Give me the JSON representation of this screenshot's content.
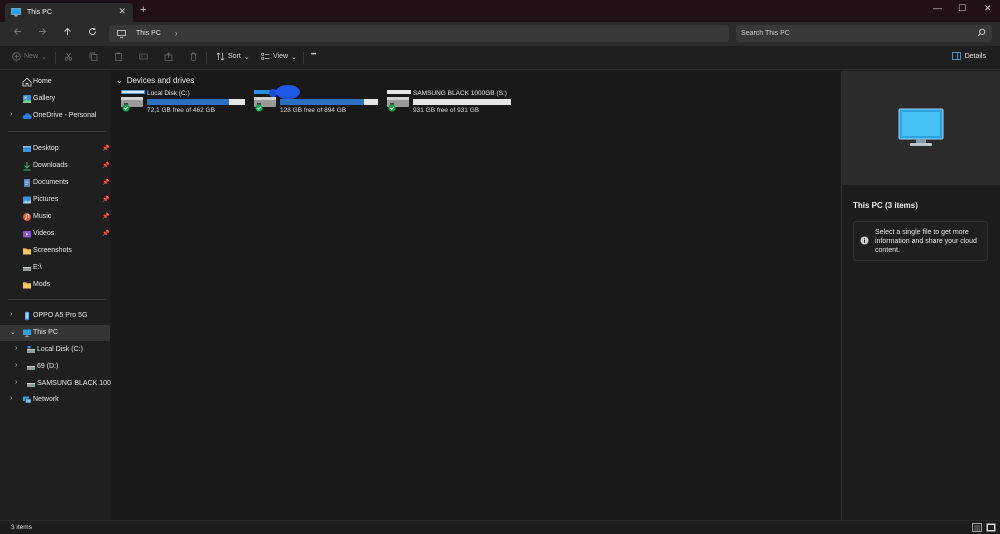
{
  "window": {
    "tab_title": "This PC",
    "close_tab_glyph": "✕",
    "new_tab_glyph": "+",
    "minimize_glyph": "—",
    "maximize_glyph": "☐",
    "close_glyph": "✕"
  },
  "address": {
    "location": "This PC",
    "search_placeholder": "Search This PC"
  },
  "command_bar": {
    "new_label": "New",
    "sort_label": "Sort",
    "view_label": "View",
    "more_glyph": "•••",
    "details_label": "Details"
  },
  "sidebar": {
    "quick": [
      {
        "label": "Home",
        "icon": "home-icon"
      },
      {
        "label": "Gallery",
        "icon": "gallery-icon"
      },
      {
        "label": "OneDrive - Personal",
        "icon": "cloud-icon"
      }
    ],
    "pinned": [
      {
        "label": "Desktop",
        "icon": "desktop-folder-icon"
      },
      {
        "label": "Downloads",
        "icon": "download-icon"
      },
      {
        "label": "Documents",
        "icon": "documents-icon"
      },
      {
        "label": "Pictures",
        "icon": "pictures-icon"
      },
      {
        "label": "Music",
        "icon": "music-icon"
      },
      {
        "label": "Videos",
        "icon": "videos-icon"
      },
      {
        "label": "Screenshots",
        "icon": "folder-icon"
      },
      {
        "label": "E:\\",
        "icon": "drive-icon"
      },
      {
        "label": "Mods",
        "icon": "folder-icon"
      }
    ],
    "devices": [
      {
        "label": "OPPO A5 Pro 5G",
        "icon": "phone-icon"
      },
      {
        "label": "This PC",
        "icon": "pc-icon"
      },
      {
        "label": "Local Disk (C:)",
        "icon": "drive-icon"
      },
      {
        "label": "69 (D:)",
        "icon": "drive-icon"
      },
      {
        "label": "SAMSUNG BLACK 1000GB",
        "icon": "drive-icon"
      },
      {
        "label": "Network",
        "icon": "network-icon"
      }
    ]
  },
  "content": {
    "group_title": "Devices and drives",
    "drives": [
      {
        "name": "Local Disk (C:)",
        "free": "72,1 GB free of 462 GB",
        "used_fraction": 0.84
      },
      {
        "name": "",
        "free": "128 GB free of 894 GB",
        "used_fraction": 0.86
      },
      {
        "name": "SAMSUNG BLACK 1000GB (S:)",
        "free": "931 GB free of 931 GB",
        "used_fraction": 0.0
      }
    ]
  },
  "details": {
    "title": "This PC (3 items)",
    "message": "Select a single file to get more information and share your cloud content."
  },
  "status": {
    "count": "3 items"
  },
  "colors": {
    "accent": "#2f6fc0",
    "check": "#16a34a",
    "titlebar": "#1f1117"
  }
}
